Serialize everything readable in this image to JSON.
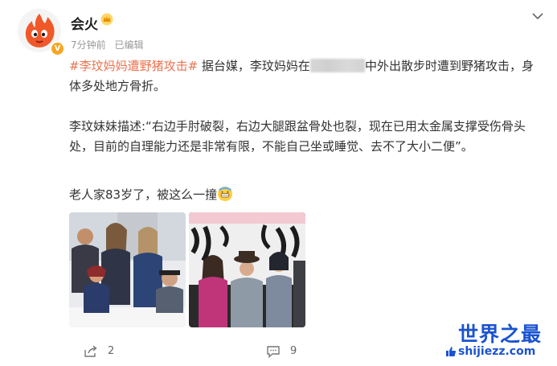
{
  "author": {
    "name": "会火",
    "avatar_icon": "flame-mascot-icon",
    "badge_icon": "verified-badge-icon",
    "badge_letter": "V",
    "crown_icon": "crown-icon"
  },
  "meta": {
    "time": "7分钟前",
    "edited": "已编辑"
  },
  "post": {
    "hashtag": "#李玟妈妈遭野猪攻击#",
    "p1_before_redaction": "据台媒，李玟妈妈在",
    "p1_after_redaction": "中外出散步时遭到野猪攻击，身体多处地方骨折。",
    "p2": "李玟妹妹描述:“右边手肘破裂，右边大腿跟盆骨处也裂，现在已用太金属支撑受伤骨头处，目前的自理能力还是非常有限，不能自己坐或睡觉、去不了大小二便”。",
    "p3": "老人家83岁了，被这么一撞"
  },
  "actions": {
    "share_count": "2",
    "comment_count": "9"
  },
  "watermark": {
    "cn": "世界之最",
    "en": "shijiezz.com"
  },
  "colors": {
    "hashtag": "#eb7350",
    "watermark": "#1a53d1",
    "badge": "#f6a623"
  }
}
